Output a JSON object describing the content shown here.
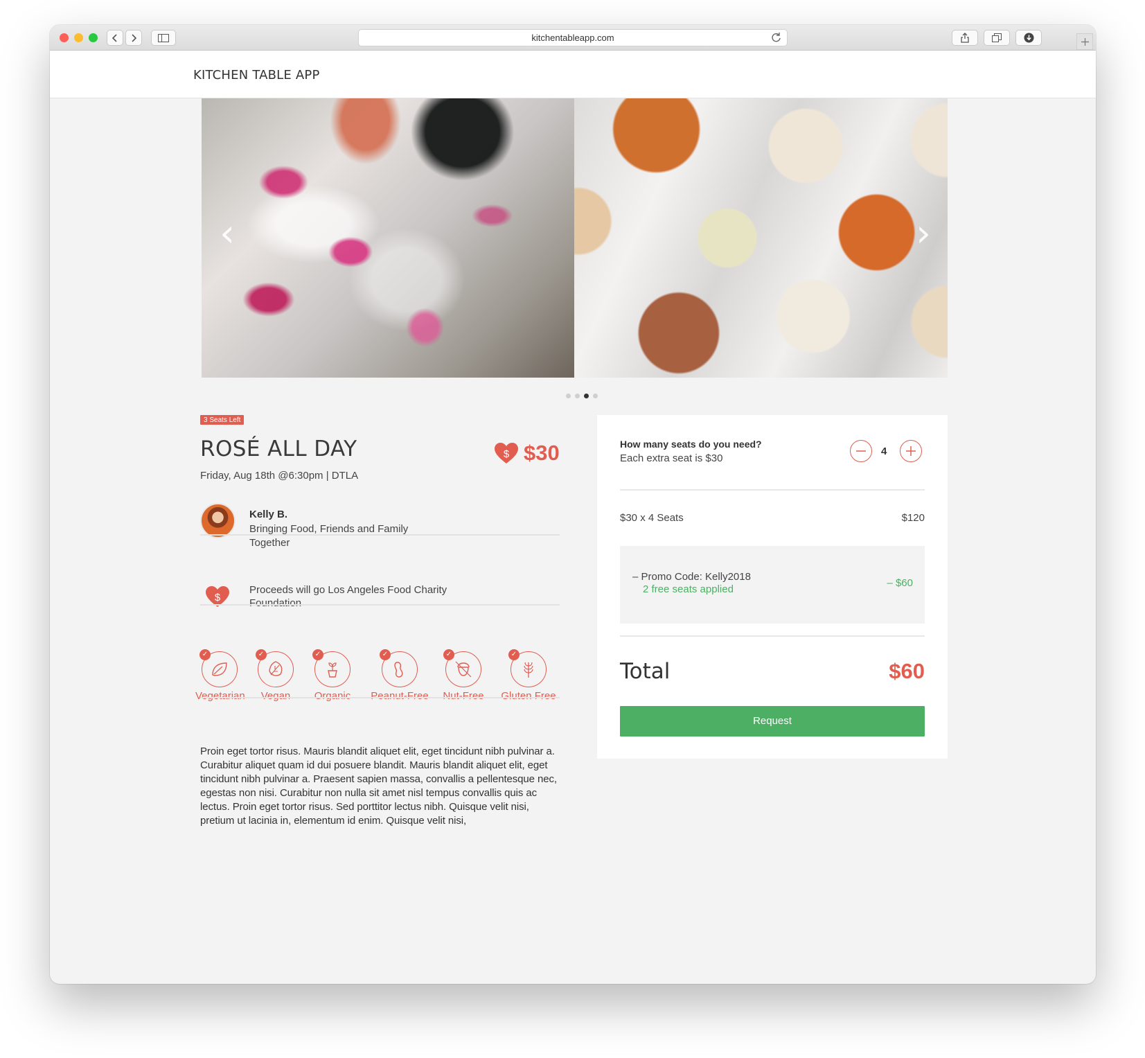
{
  "browser": {
    "url": "kitchentableapp.com"
  },
  "header": {
    "brand": "KITCHEN TABLE APP"
  },
  "carousel": {
    "slides": 4,
    "active_index": 2
  },
  "event": {
    "badge": "3 Seats Left",
    "title": "ROSÉ ALL DAY",
    "meta": "Friday, Aug 18th @6:30pm | DTLA",
    "price": "$30"
  },
  "host": {
    "name": "Kelly B.",
    "tagline": "Bringing Food, Friends and Family Together"
  },
  "charity": {
    "text": "Proceeds will go Los Angeles Food Charity Foundation"
  },
  "dietary": [
    {
      "label": "Vegetarian",
      "icon": "leaf-icon"
    },
    {
      "label": "Vegan",
      "icon": "leaf-outline-icon"
    },
    {
      "label": "Organic",
      "icon": "potted-plant-icon"
    },
    {
      "label": "Peanut-Free",
      "icon": "peanut-icon"
    },
    {
      "label": "Nut-Free",
      "icon": "nut-icon"
    },
    {
      "label": "Gluten Free",
      "icon": "wheat-icon"
    }
  ],
  "description": "Proin eget tortor risus. Mauris blandit aliquet elit, eget tincidunt nibh pulvinar a. Curabitur aliquet quam id dui posuere blandit. Mauris blandit aliquet elit, eget tincidunt nibh pulvinar a. Praesent sapien massa, convallis a pellentesque nec, egestas non nisi. Curabitur non nulla sit amet nisl tempus convallis quis ac lectus. Proin eget tortor risus. Sed porttitor lectus nibh. Quisque velit nisi, pretium ut lacinia in, elementum id enim. Quisque velit nisi,",
  "booking": {
    "question": "How many seats do you need?",
    "subtext": "Each extra seat is $30",
    "seats": "4",
    "line_label": "$30 x 4 Seats",
    "line_value": "$120",
    "promo_code": "– Promo Code: Kelly2018",
    "promo_sub": "2 free seats applied",
    "promo_discount": "– $60",
    "total_label": "Total",
    "total_value": "$60",
    "request_label": "Request"
  },
  "colors": {
    "accent": "#e05d50",
    "success": "#4caf63",
    "background": "#f3f3f4"
  }
}
